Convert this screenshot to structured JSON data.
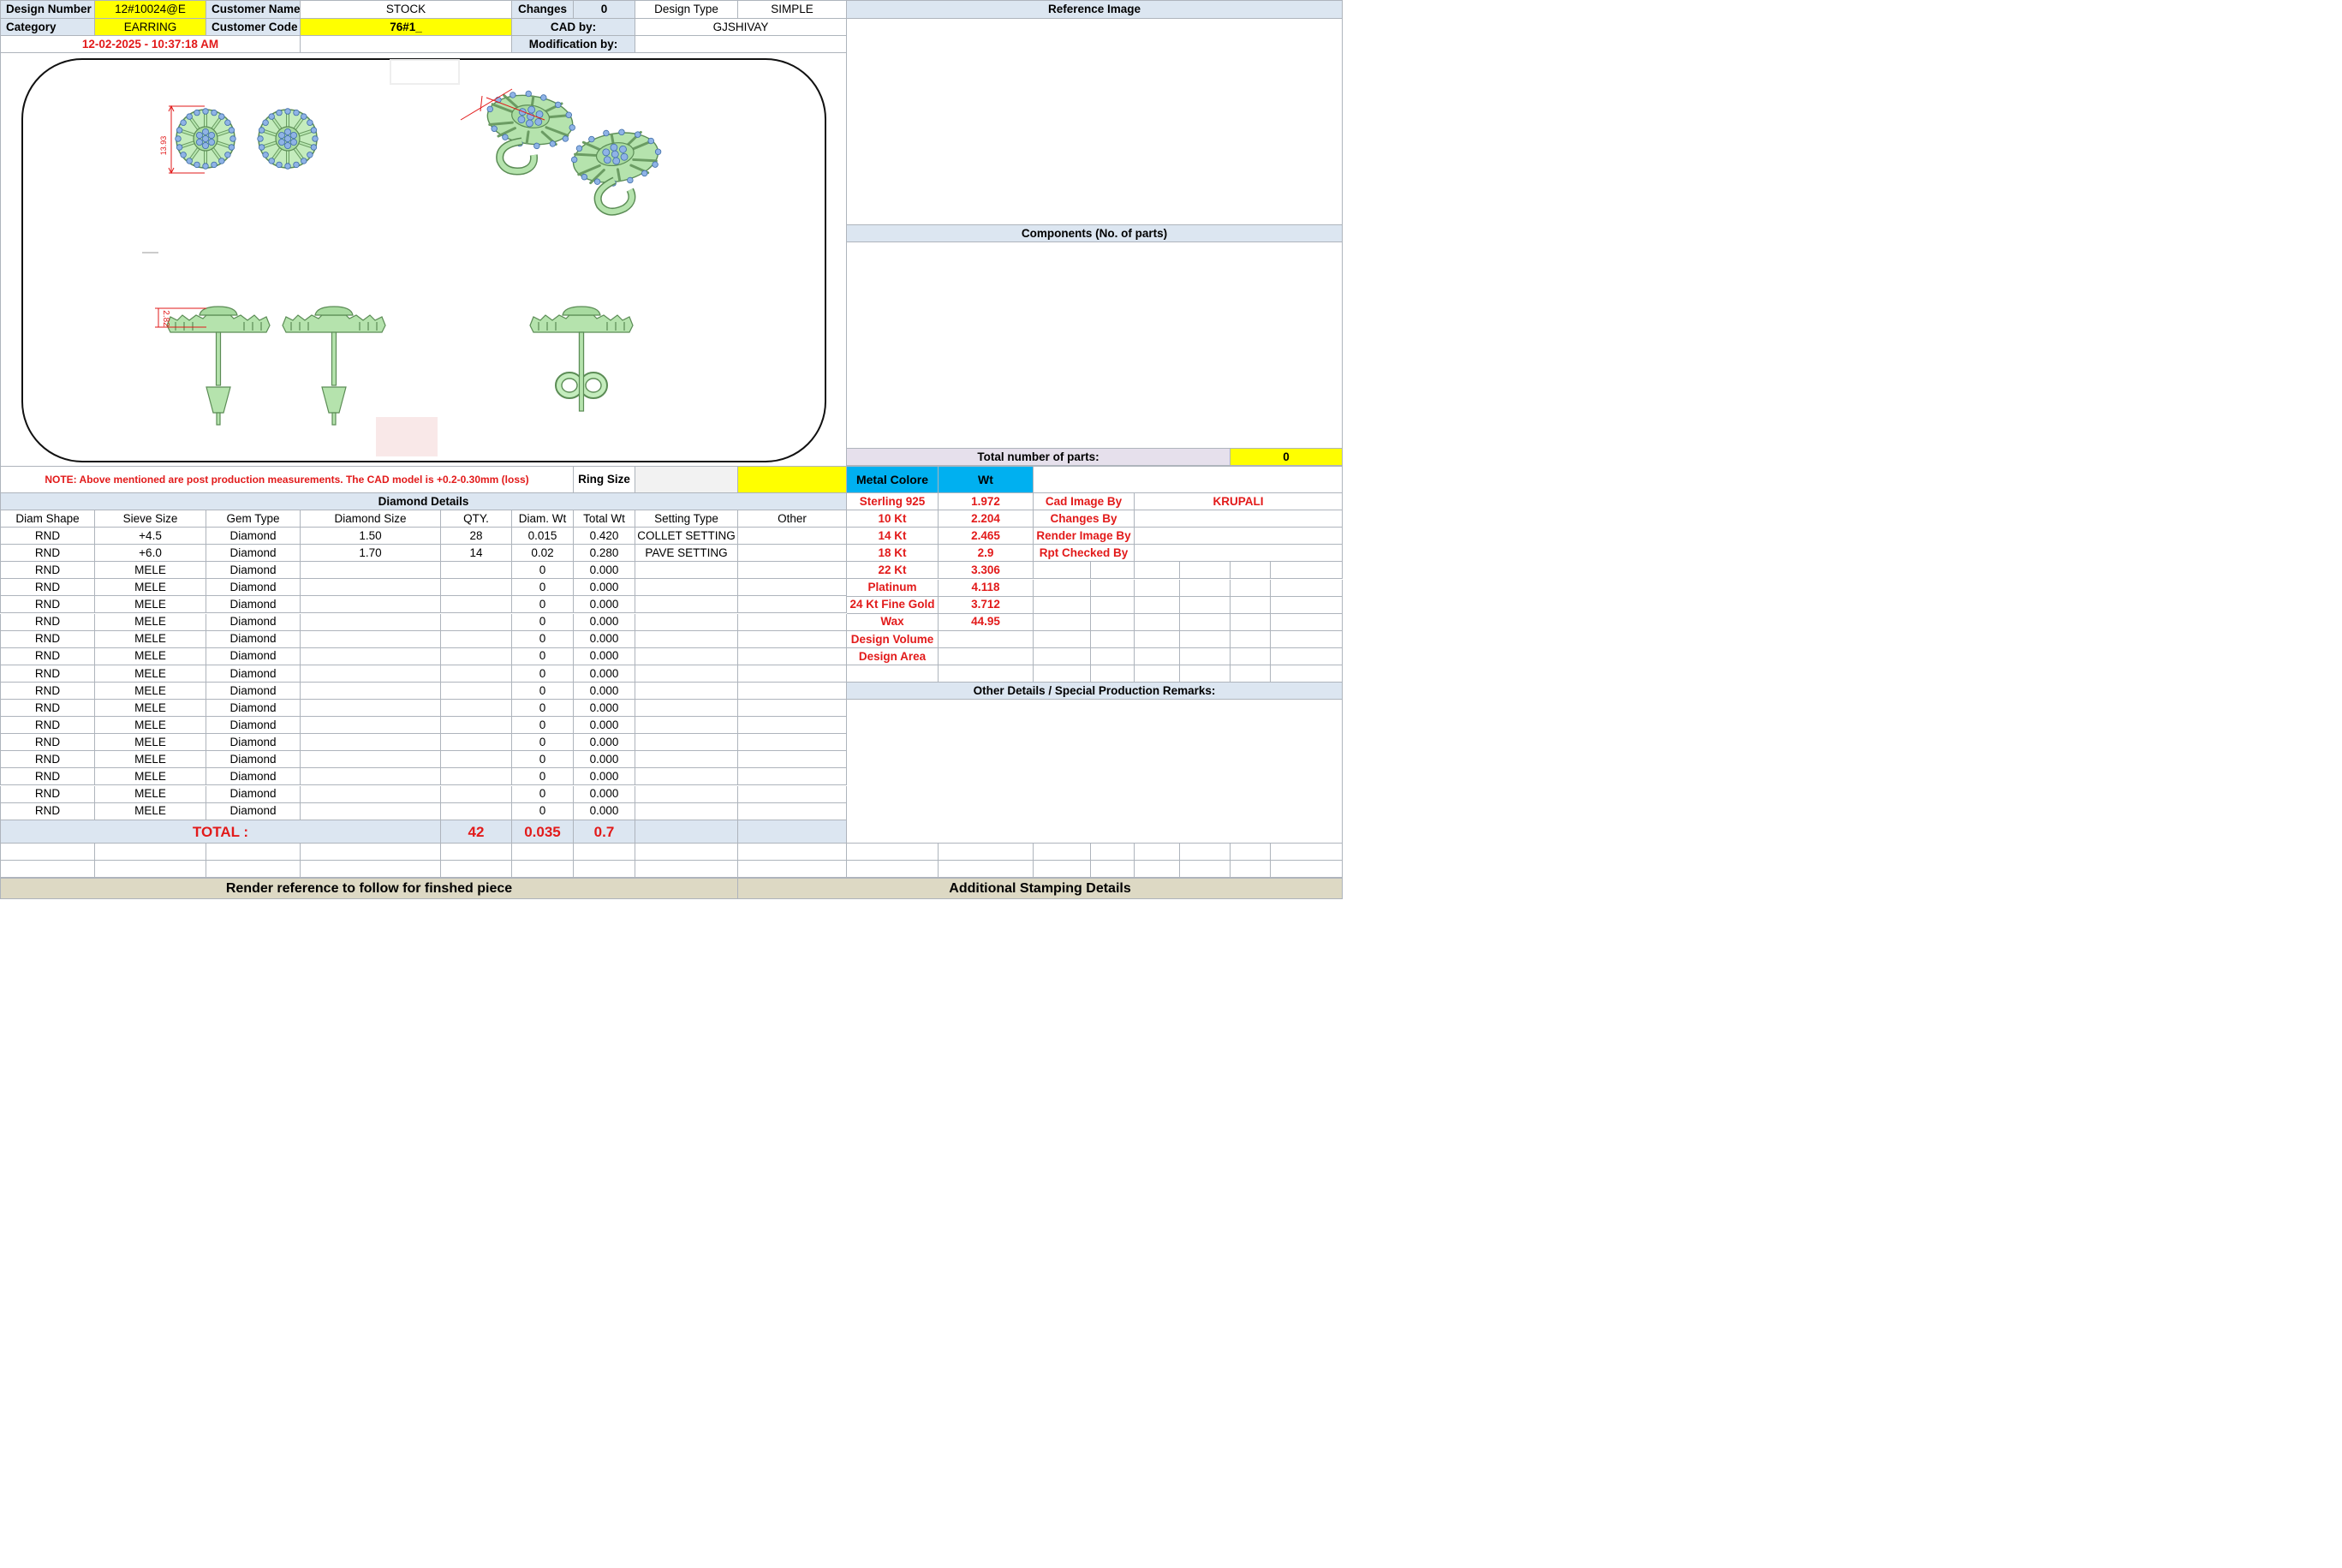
{
  "header": {
    "design_number_label": "Design Number",
    "design_number": "12#10024@E",
    "customer_name_label": "Customer Name",
    "customer_name": "STOCK",
    "changes_label": "Changes",
    "changes": "0",
    "design_type_label": "Design Type",
    "design_type": "SIMPLE",
    "category_label": "Category",
    "category": "EARRING",
    "customer_code_label": "Customer Code",
    "customer_code": "76#1_",
    "cad_by_label": "CAD by:",
    "cad_by": "GJSHIVAY",
    "timestamp": "12-02-2025 - 10:37:18 AM",
    "modification_by_label": "Modification by:",
    "modification_by": ""
  },
  "drawing": {
    "dim_top": "13.93",
    "dim_side": "2.82"
  },
  "right_panel": {
    "reference_image_title": "Reference Image",
    "components_title": "Components (No. of parts)",
    "total_parts_label": "Total number of parts:",
    "total_parts": "0"
  },
  "note": "NOTE: Above mentioned are post production measurements. The CAD model is +0.2-0.30mm (loss)",
  "ring_size_label": "Ring Size",
  "ring_size": "",
  "diamond": {
    "title": "Diamond Details",
    "columns": [
      "Diam Shape",
      "Sieve Size",
      "Gem Type",
      "Diamond Size",
      "QTY.",
      "Diam. Wt",
      "Total Wt",
      "Setting Type",
      "Other"
    ],
    "rows": [
      [
        "RND",
        "+4.5",
        "Diamond",
        "1.50",
        "28",
        "0.015",
        "0.420",
        "COLLET SETTING",
        ""
      ],
      [
        "RND",
        "+6.0",
        "Diamond",
        "1.70",
        "14",
        "0.02",
        "0.280",
        "PAVE SETTING",
        ""
      ],
      [
        "RND",
        "MELE",
        "Diamond",
        "",
        "",
        "0",
        "0.000",
        "",
        ""
      ],
      [
        "RND",
        "MELE",
        "Diamond",
        "",
        "",
        "0",
        "0.000",
        "",
        ""
      ],
      [
        "RND",
        "MELE",
        "Diamond",
        "",
        "",
        "0",
        "0.000",
        "",
        ""
      ],
      [
        "RND",
        "MELE",
        "Diamond",
        "",
        "",
        "0",
        "0.000",
        "",
        ""
      ],
      [
        "RND",
        "MELE",
        "Diamond",
        "",
        "",
        "0",
        "0.000",
        "",
        ""
      ],
      [
        "RND",
        "MELE",
        "Diamond",
        "",
        "",
        "0",
        "0.000",
        "",
        ""
      ],
      [
        "RND",
        "MELE",
        "Diamond",
        "",
        "",
        "0",
        "0.000",
        "",
        ""
      ],
      [
        "RND",
        "MELE",
        "Diamond",
        "",
        "",
        "0",
        "0.000",
        "",
        ""
      ],
      [
        "RND",
        "MELE",
        "Diamond",
        "",
        "",
        "0",
        "0.000",
        "",
        ""
      ],
      [
        "RND",
        "MELE",
        "Diamond",
        "",
        "",
        "0",
        "0.000",
        "",
        ""
      ],
      [
        "RND",
        "MELE",
        "Diamond",
        "",
        "",
        "0",
        "0.000",
        "",
        ""
      ],
      [
        "RND",
        "MELE",
        "Diamond",
        "",
        "",
        "0",
        "0.000",
        "",
        ""
      ],
      [
        "RND",
        "MELE",
        "Diamond",
        "",
        "",
        "0",
        "0.000",
        "",
        ""
      ],
      [
        "RND",
        "MELE",
        "Diamond",
        "",
        "",
        "0",
        "0.000",
        "",
        ""
      ],
      [
        "RND",
        "MELE",
        "Diamond",
        "",
        "",
        "0",
        "0.000",
        "",
        ""
      ]
    ],
    "total_label": "TOTAL :",
    "total_qty": "42",
    "total_diam_wt": "0.035",
    "total_wt": "0.7"
  },
  "metal": {
    "colore_label": "Metal Colore",
    "wt_label": "Wt",
    "rows": [
      [
        "Sterling 925",
        "1.972"
      ],
      [
        "10 Kt",
        "2.204"
      ],
      [
        "14 Kt",
        "2.465"
      ],
      [
        "18 Kt",
        "2.9"
      ],
      [
        "22 Kt",
        "3.306"
      ],
      [
        "Platinum",
        "4.118"
      ],
      [
        "24 Kt Fine Gold",
        "3.712"
      ],
      [
        "Wax",
        "44.95"
      ],
      [
        "Design Volume",
        ""
      ],
      [
        "Design Area",
        ""
      ]
    ]
  },
  "credits": {
    "rows": [
      [
        "Cad Image By",
        "KRUPALI"
      ],
      [
        "Changes By",
        ""
      ],
      [
        "Render Image By",
        ""
      ],
      [
        "Rpt Checked By",
        ""
      ]
    ]
  },
  "other_details_title": "Other Details / Special Production Remarks:",
  "footer": {
    "render_reference": "Render reference to follow for finshed piece",
    "additional_stamping": "Additional Stamping Details"
  },
  "colors": {
    "yellow": "#ffff00",
    "header_blue": "#dce6f1",
    "metal_cyan": "#00b0f0",
    "red_text": "#e21a1a",
    "render_green": "#a8dba0",
    "stone_blue": "#8fb3e6",
    "footer_tan": "#ddd9c4"
  }
}
